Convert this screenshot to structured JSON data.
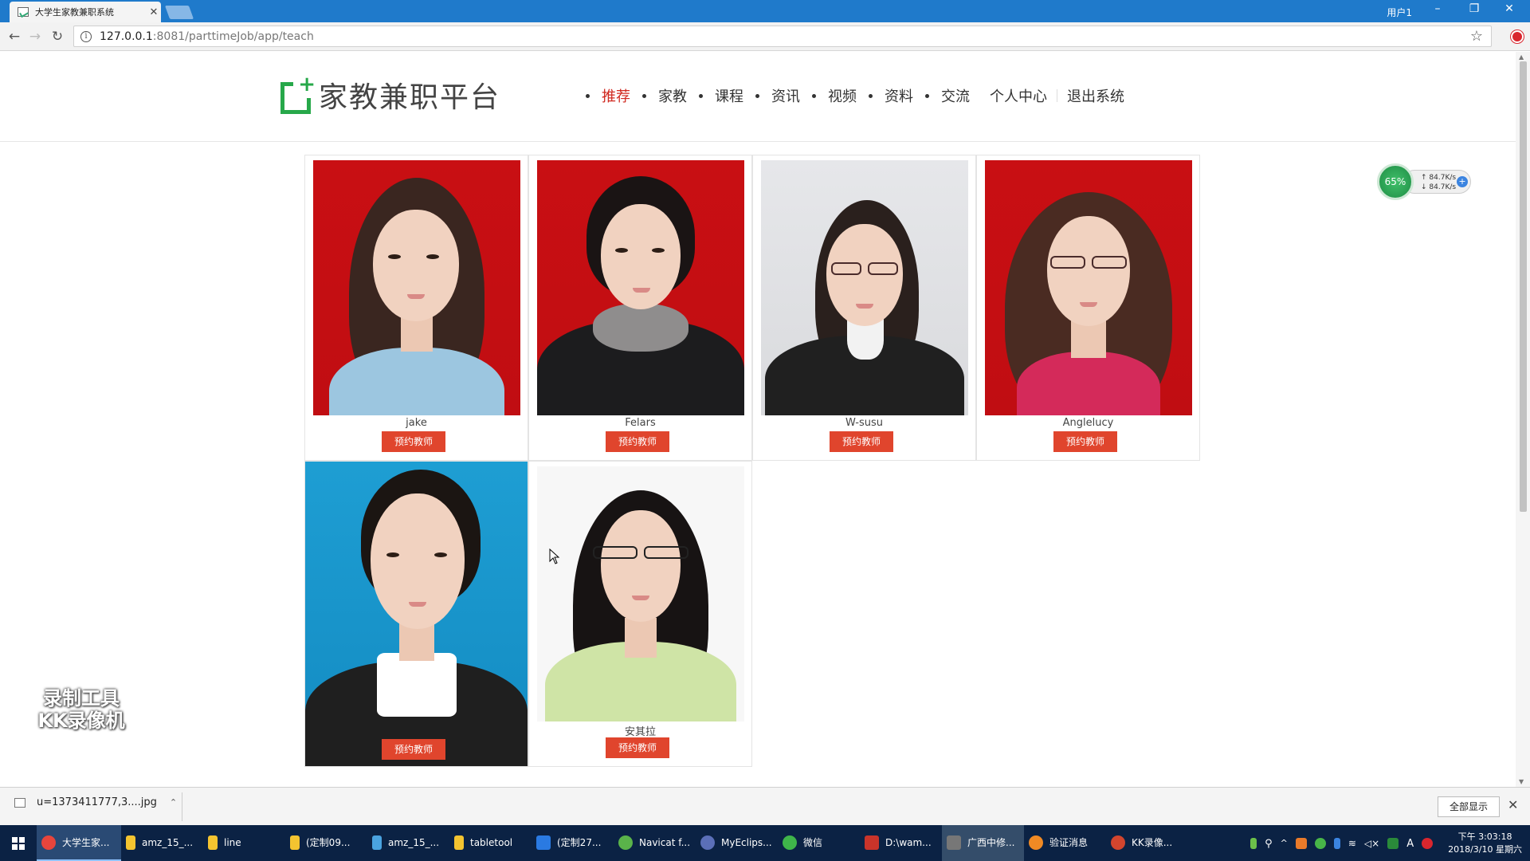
{
  "browser": {
    "tab_title": "大学生家教兼职系统",
    "tab_close": "✕",
    "user_label": "用户1",
    "url_host": "127.0.0.1",
    "url_path": ":8081/parttimeJob/app/teach"
  },
  "site": {
    "logo_text": "家教兼职平台",
    "nav": [
      {
        "label": "推荐",
        "active": true
      },
      {
        "label": "家教"
      },
      {
        "label": "课程"
      },
      {
        "label": "资讯"
      },
      {
        "label": "视频"
      },
      {
        "label": "资料"
      },
      {
        "label": "交流"
      },
      {
        "label": "个人中心"
      },
      {
        "label": "退出系统"
      }
    ]
  },
  "teachers": [
    {
      "name": "jake",
      "button": "预约教师",
      "photo_bg": "#c70f12"
    },
    {
      "name": "Felars",
      "button": "预约教师",
      "photo_bg": "#c70f12"
    },
    {
      "name": "W-susu",
      "button": "预约教师",
      "photo_bg": "#e3e4e7"
    },
    {
      "name": "Anglelucy",
      "button": "预约教师",
      "photo_bg": "#c70f12"
    },
    {
      "name": "",
      "button": "预约教师",
      "photo_bg": "#1a98cf"
    },
    {
      "name": "安其拉",
      "button": "预约教师",
      "photo_bg": "#f7f7f7"
    }
  ],
  "widget": {
    "percent": "65%",
    "up_speed": "↑ 84.7K/s",
    "down_speed": "↓ 84.7K/s",
    "plus": "+"
  },
  "watermark": {
    "line1": "录制工具",
    "line2": "KK录像机"
  },
  "downloads": {
    "file": "u=1373411777,3....jpg",
    "show_all": "全部显示",
    "close": "✕"
  },
  "taskbar": {
    "items": [
      {
        "label": "大学生家...",
        "color": "#e8453c"
      },
      {
        "label": "amz_15_...",
        "color": "#f4c430"
      },
      {
        "label": "line",
        "color": "#f4c430"
      },
      {
        "label": "(定制09...",
        "color": "#f4c430"
      },
      {
        "label": "amz_15_...",
        "color": "#4aa3e0"
      },
      {
        "label": "tabletool",
        "color": "#f4c430"
      },
      {
        "label": "(定制27...",
        "color": "#2a7ae2"
      },
      {
        "label": "Navicat f...",
        "color": "#5ab34a"
      },
      {
        "label": "MyEclips...",
        "color": "#5b6fb8"
      },
      {
        "label": "微信",
        "color": "#3fb54a"
      },
      {
        "label": "D:\\wam...",
        "color": "#c9342a"
      },
      {
        "label": "广西中修...",
        "color": "#777777"
      },
      {
        "label": "验证消息",
        "color": "#f08a24"
      },
      {
        "label": "KK录像...",
        "color": "#d2452e"
      }
    ],
    "time": "下午 3:03:18",
    "date": "2018/3/10 星期六",
    "ime": "A"
  }
}
